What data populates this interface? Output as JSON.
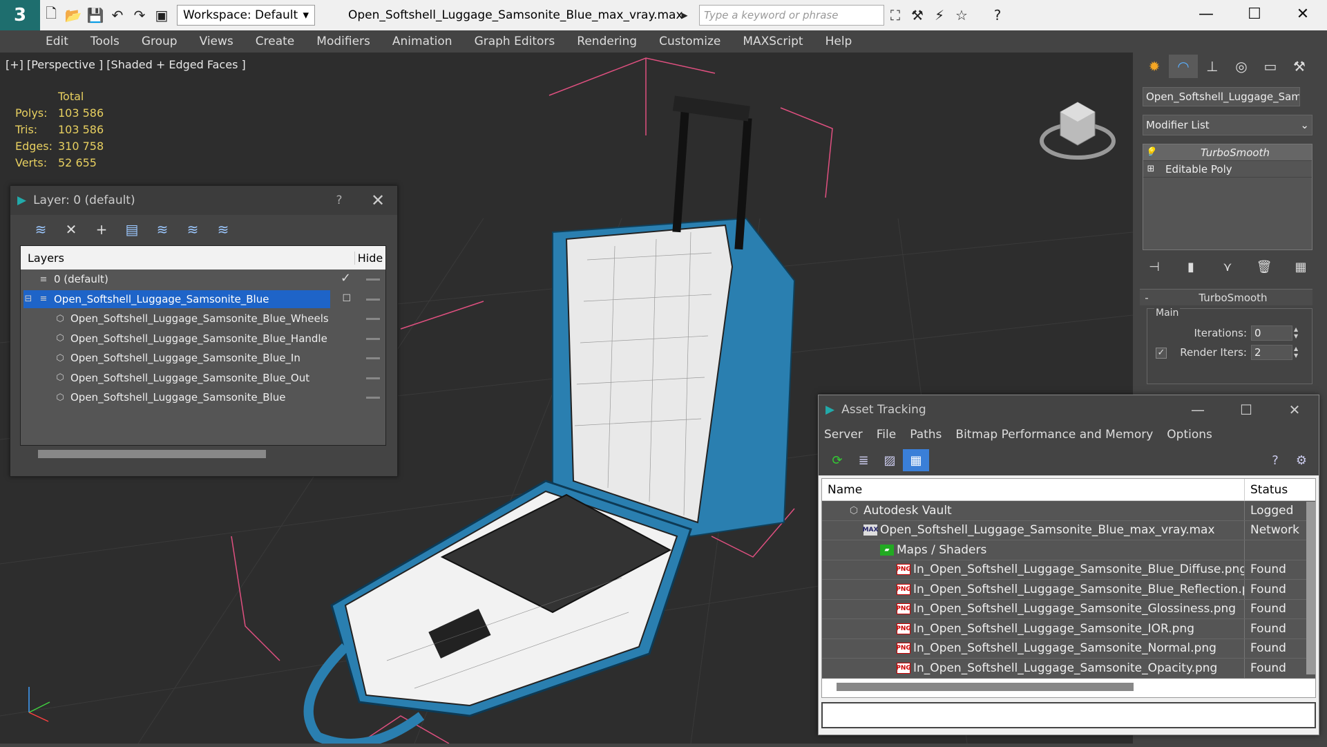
{
  "titlebar": {
    "workspace": "Workspace: Default",
    "doc_title": "Open_Softshell_Luggage_Samsonite_Blue_max_vray.max",
    "search_placeholder": "Type a keyword or phrase"
  },
  "menu": [
    "Edit",
    "Tools",
    "Group",
    "Views",
    "Create",
    "Modifiers",
    "Animation",
    "Graph Editors",
    "Rendering",
    "Customize",
    "MAXScript",
    "Help"
  ],
  "viewport": {
    "label": "[+] [Perspective ] [Shaded + Edged Faces ]",
    "stats": {
      "header": "Total",
      "rows": [
        {
          "k": "Polys:",
          "v": "103 586"
        },
        {
          "k": "Tris:",
          "v": "103 586"
        },
        {
          "k": "Edges:",
          "v": "310 758"
        },
        {
          "k": "Verts:",
          "v": "52 655"
        }
      ]
    }
  },
  "layer_dialog": {
    "title": "Layer: 0 (default)",
    "help": "?",
    "col_layers": "Layers",
    "col_hide": "Hide",
    "rows": [
      {
        "name": "0 (default)",
        "indent": 1
      },
      {
        "name": "Open_Softshell_Luggage_Samsonite_Blue",
        "indent": 0
      },
      {
        "name": "Open_Softshell_Luggage_Samsonite_Blue_Wheels",
        "indent": 2
      },
      {
        "name": "Open_Softshell_Luggage_Samsonite_Blue_Handle",
        "indent": 2
      },
      {
        "name": "Open_Softshell_Luggage_Samsonite_Blue_In",
        "indent": 2
      },
      {
        "name": "Open_Softshell_Luggage_Samsonite_Blue_Out",
        "indent": 2
      },
      {
        "name": "Open_Softshell_Luggage_Samsonite_Blue",
        "indent": 2
      }
    ]
  },
  "command_panel": {
    "object_name": "Open_Softshell_Luggage_Samso",
    "modifier_list": "Modifier List",
    "stack": [
      "TurboSmooth",
      "Editable Poly"
    ],
    "rollout_title": "TurboSmooth",
    "group_label": "Main",
    "iterations_label": "Iterations:",
    "iterations_value": "0",
    "render_iters_label": "Render Iters:",
    "render_iters_value": "2"
  },
  "asset_tracking": {
    "title": "Asset Tracking",
    "menu": [
      "Server",
      "File",
      "Paths",
      "Bitmap Performance and Memory",
      "Options"
    ],
    "col_name": "Name",
    "col_status": "Status",
    "rows": [
      {
        "name": "Autodesk Vault",
        "status": "Logged",
        "icon": "vault",
        "indent": 1
      },
      {
        "name": "Open_Softshell_Luggage_Samsonite_Blue_max_vray.max",
        "status": "Network",
        "icon": "max",
        "indent": 2
      },
      {
        "name": "Maps / Shaders",
        "status": "",
        "icon": "maps",
        "indent": 3
      },
      {
        "name": "In_Open_Softshell_Luggage_Samsonite_Blue_Diffuse.png",
        "status": "Found",
        "icon": "png",
        "indent": 4
      },
      {
        "name": "In_Open_Softshell_Luggage_Samsonite_Blue_Reflection.png",
        "status": "Found",
        "icon": "png",
        "indent": 4
      },
      {
        "name": "In_Open_Softshell_Luggage_Samsonite_Glossiness.png",
        "status": "Found",
        "icon": "png",
        "indent": 4
      },
      {
        "name": "In_Open_Softshell_Luggage_Samsonite_IOR.png",
        "status": "Found",
        "icon": "png",
        "indent": 4
      },
      {
        "name": "In_Open_Softshell_Luggage_Samsonite_Normal.png",
        "status": "Found",
        "icon": "png",
        "indent": 4
      },
      {
        "name": "In_Open_Softshell_Luggage_Samsonite_Opacity.png",
        "status": "Found",
        "icon": "png",
        "indent": 4
      }
    ]
  },
  "colors": {
    "accent": "#1e64c8",
    "stats": "#e8d060",
    "luggage_blue": "#2a7fb0"
  }
}
